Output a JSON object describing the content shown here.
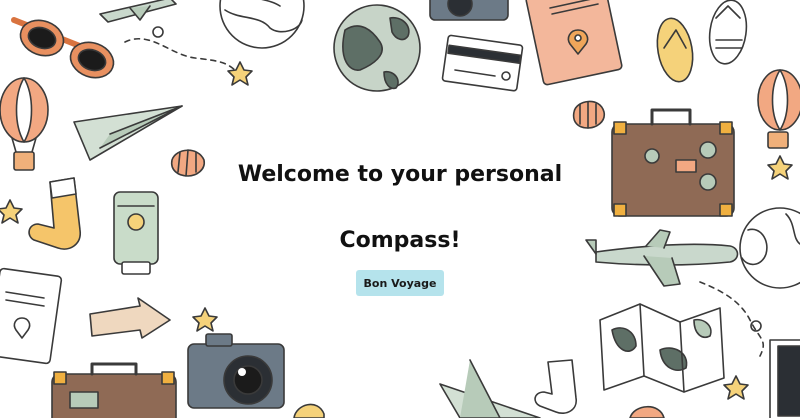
{
  "hero": {
    "title_line1": "Welcome to your personal",
    "title_line2": "Compass!",
    "button_label": "Bon Voyage"
  },
  "colors": {
    "button_bg": "#b5e3ec",
    "title_text": "#111111",
    "outline": "#3a3a3a",
    "peach": "#f2a882",
    "sage": "#b7cbb9",
    "brown": "#8f6a55",
    "yellow": "#f5d27a"
  },
  "decorations": [
    "sunglasses-icon",
    "airplane-icon",
    "globe-icon",
    "boarding-pass-icon",
    "camera-icon",
    "passport-icon",
    "flip-flops-icon",
    "hot-air-balloon-icon",
    "paper-plane-icon",
    "seashell-icon",
    "suitcase-icon",
    "star-icon",
    "sock-icon",
    "sunscreen-icon",
    "map-icon",
    "arrow-sign-icon"
  ]
}
